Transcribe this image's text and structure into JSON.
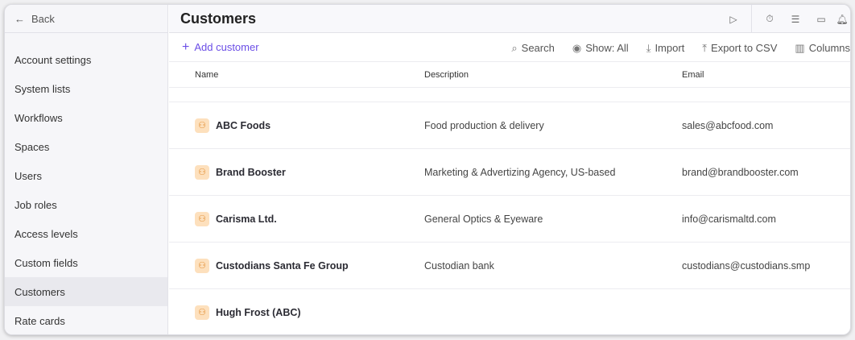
{
  "sidebar": {
    "back": "Back",
    "items": [
      "Account settings",
      "System lists",
      "Workflows",
      "Spaces",
      "Users",
      "Job roles",
      "Access levels",
      "Custom fields",
      "Customers",
      "Rate cards"
    ],
    "selected": "Customers"
  },
  "header": {
    "title": "Customers"
  },
  "toolbar": {
    "add": "Add customer",
    "search": "Search",
    "show": "Show: All",
    "import": "Import",
    "export": "Export to CSV",
    "columns": "Columns"
  },
  "table": {
    "columns": [
      "Name",
      "Description",
      "Email"
    ],
    "rows": [
      {
        "name": "ABC Foods",
        "description": "Food production & delivery",
        "email": "sales@abcfood.com"
      },
      {
        "name": "Brand Booster",
        "description": "Marketing & Advertizing Agency, US-based",
        "email": "brand@brandbooster.com"
      },
      {
        "name": "Carisma Ltd.",
        "description": "General Optics & Eyeware",
        "email": "info@carismaltd.com"
      },
      {
        "name": "Custodians Santa Fe Group",
        "description": "Custodian bank",
        "email": "custodians@custodians.smp"
      },
      {
        "name": "Hugh Frost (ABC)",
        "description": "",
        "email": ""
      }
    ]
  },
  "colors": {
    "accent": "#6b4ee6",
    "customer_icon_bg": "#fde0bd"
  }
}
